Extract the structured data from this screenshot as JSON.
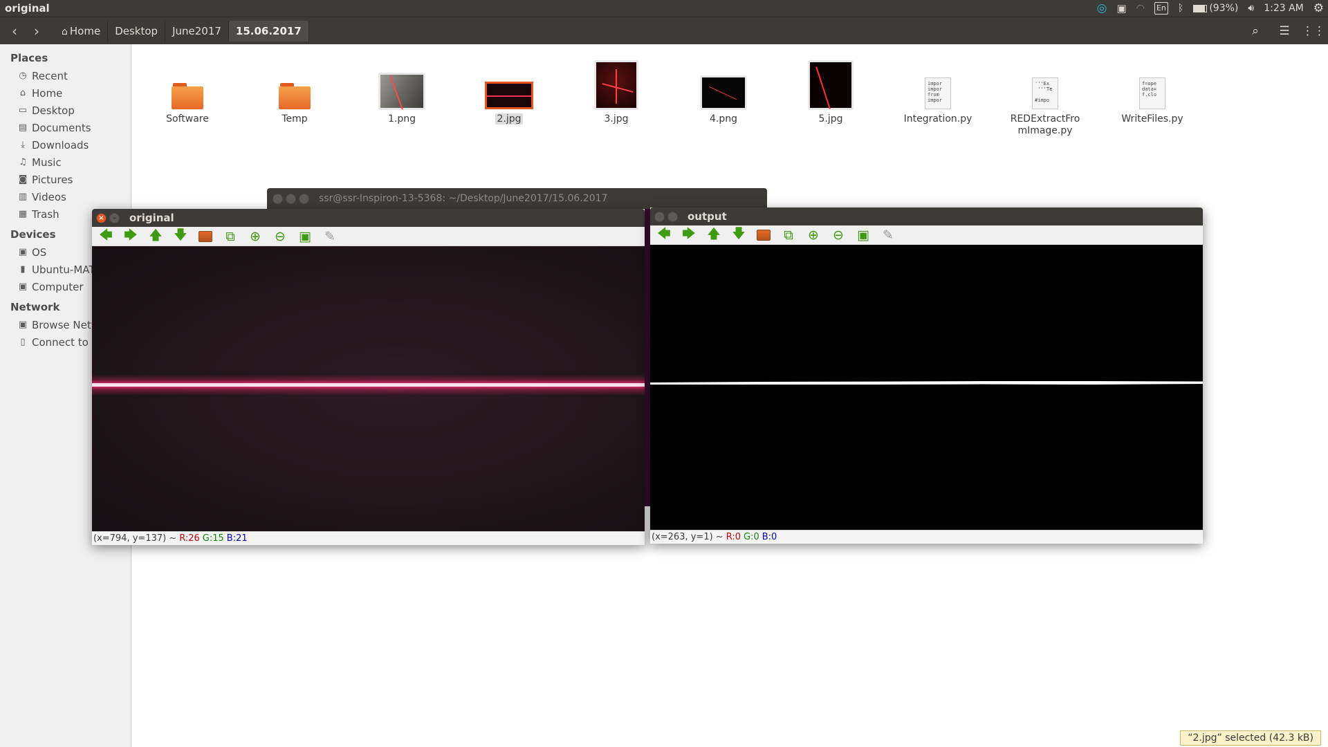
{
  "topbar": {
    "title": "original",
    "battery": "(93%)",
    "keyboard": "En",
    "time": "1:23 AM",
    "icons": [
      "app-indicator-icon",
      "network-error-icon",
      "wifi-icon",
      "keyboard-icon",
      "bluetooth-icon",
      "battery-icon",
      "volume-icon",
      "settings-icon"
    ]
  },
  "nav": {
    "crumbs": [
      "Home",
      "Desktop",
      "June2017",
      "15.06.2017"
    ]
  },
  "sidebar": {
    "places_title": "Places",
    "places": [
      {
        "label": "Recent",
        "icon": "clock-icon"
      },
      {
        "label": "Home",
        "icon": "home-icon"
      },
      {
        "label": "Desktop",
        "icon": "desktop-icon"
      },
      {
        "label": "Documents",
        "icon": "document-icon"
      },
      {
        "label": "Downloads",
        "icon": "download-icon"
      },
      {
        "label": "Music",
        "icon": "music-icon"
      },
      {
        "label": "Pictures",
        "icon": "camera-icon"
      },
      {
        "label": "Videos",
        "icon": "film-icon"
      },
      {
        "label": "Trash",
        "icon": "trash-icon"
      }
    ],
    "devices_title": "Devices",
    "devices": [
      {
        "label": "OS",
        "icon": "drive-icon"
      },
      {
        "label": "Ubuntu-MATE",
        "icon": "usb-icon"
      },
      {
        "label": "Computer",
        "icon": "computer-icon"
      }
    ],
    "network_title": "Network",
    "network": [
      {
        "label": "Browse Network",
        "icon": "network-icon"
      },
      {
        "label": "Connect to Server",
        "icon": "server-icon"
      }
    ]
  },
  "files": [
    {
      "name": "Software",
      "type": "folder"
    },
    {
      "name": "Temp",
      "type": "folder"
    },
    {
      "name": "1.png",
      "type": "image"
    },
    {
      "name": "2.jpg",
      "type": "image",
      "selected": true
    },
    {
      "name": "3.jpg",
      "type": "image"
    },
    {
      "name": "4.png",
      "type": "image"
    },
    {
      "name": "5.jpg",
      "type": "image"
    },
    {
      "name": "Integration.py",
      "type": "python",
      "preview": "impor\nimpor\nfrom\nimpor"
    },
    {
      "name": "REDExtractFromImage.py",
      "type": "python",
      "preview": "'''Ex\n '''Te\n\n#impo"
    },
    {
      "name": "WriteFiles.py",
      "type": "python",
      "preview": "f=ope\ndata=\nf.clo"
    }
  ],
  "terminal": {
    "title": "ssr@ssr-Inspiron-13-5368: ~/Desktop/June2017/15.06.2017"
  },
  "original_window": {
    "title": "original",
    "status_coords": "(x=794, y=137) ~",
    "r": "R:26",
    "g": "G:15",
    "b": "B:21"
  },
  "output_window": {
    "title": "output",
    "status_coords": "(x=263, y=1) ~",
    "r": "R:0",
    "g": "G:0",
    "b": "B:0"
  },
  "selection_status": "“2.jpg” selected  (42.3 kB)",
  "colors": {
    "accent": "#e95420",
    "panel": "#3c3b37",
    "laser": "#ff3070"
  }
}
